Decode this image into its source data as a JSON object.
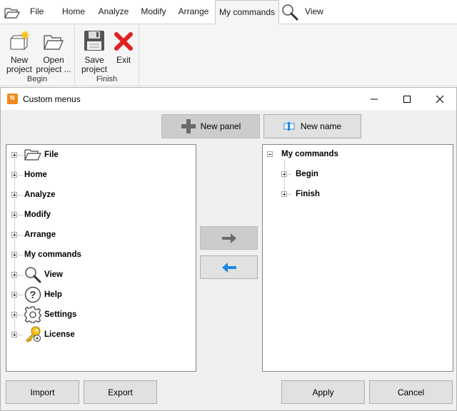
{
  "ribbon": {
    "tabs": [
      {
        "label": "File"
      },
      {
        "label": "Home"
      },
      {
        "label": "Analyze"
      },
      {
        "label": "Modify"
      },
      {
        "label": "Arrange"
      },
      {
        "label": "My commands"
      },
      {
        "label": "View"
      }
    ],
    "active_tab": "My commands",
    "groups": [
      {
        "label": "Begin",
        "buttons": [
          "New project",
          "Open project ..."
        ]
      },
      {
        "label": "Finish",
        "buttons": [
          "Save project",
          "Exit"
        ]
      }
    ],
    "btn_new_l1": "New",
    "btn_new_l2": "project",
    "btn_open_l1": "Open",
    "btn_open_l2": "project ...",
    "btn_save_l1": "Save",
    "btn_save_l2": "project",
    "btn_exit": "Exit"
  },
  "dialog": {
    "title": "Custom menus",
    "app_icon_letter": "N",
    "new_panel_label": "New panel",
    "new_name_label": "New name",
    "left_tree": [
      {
        "label": "File",
        "icon": "folder-icon"
      },
      {
        "label": "Home"
      },
      {
        "label": "Analyze"
      },
      {
        "label": "Modify"
      },
      {
        "label": "Arrange"
      },
      {
        "label": "My commands"
      },
      {
        "label": "View",
        "icon": "search-icon"
      },
      {
        "label": "Help",
        "icon": "help-icon"
      },
      {
        "label": "Settings",
        "icon": "gear-icon"
      },
      {
        "label": "License",
        "icon": "key-icon"
      }
    ],
    "right_tree": {
      "root": "My commands",
      "children": [
        {
          "label": "Begin"
        },
        {
          "label": "Finish"
        }
      ]
    },
    "import_label": "Import",
    "export_label": "Export",
    "apply_label": "Apply",
    "cancel_label": "Cancel"
  },
  "colors": {
    "accent_blue": "#1e88e5",
    "exit_red": "#e02020",
    "app_orange": "#f08a1c"
  }
}
